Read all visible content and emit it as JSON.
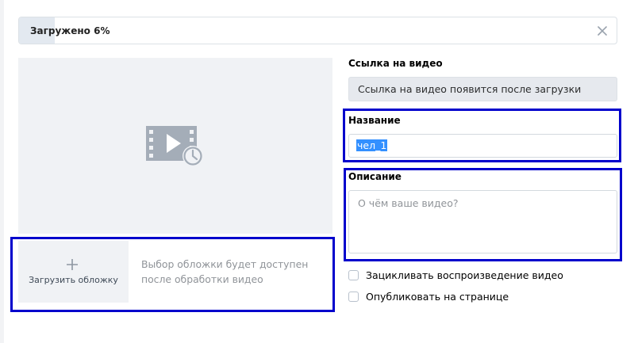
{
  "upload": {
    "status_label": "Загружено 6%",
    "progress_percent": 6,
    "close_icon": "close-icon"
  },
  "preview": {
    "icon": "video-pending-icon"
  },
  "cover": {
    "button_label": "Загрузить обложку",
    "hint": "Выбор обложки будет доступен после обработки видео",
    "icon": "plus-icon"
  },
  "link": {
    "label": "Ссылка на видео",
    "value": "Ссылка на видео появится после загрузки"
  },
  "title": {
    "label": "Название",
    "value": "чел_1"
  },
  "description": {
    "label": "Описание",
    "placeholder": "О чём ваше видео?"
  },
  "options": [
    {
      "label": "Зацикливать воспроизведение видео",
      "checked": false
    },
    {
      "label": "Опубликовать на странице",
      "checked": false
    }
  ],
  "colors": {
    "highlight": "#0000cc",
    "selection": "#3390ff"
  }
}
